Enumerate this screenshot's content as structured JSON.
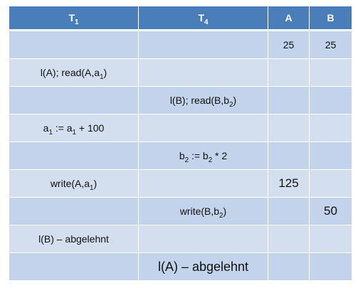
{
  "table": {
    "headers": [
      {
        "base": "T",
        "sub": "1"
      },
      {
        "base": "T",
        "sub": "4"
      },
      {
        "base": "A",
        "sub": ""
      },
      {
        "base": "B",
        "sub": ""
      }
    ],
    "rows": [
      {
        "t1": [],
        "t4": [],
        "a": "25",
        "b": "25"
      },
      {
        "t1": [
          "l(A); read(A,a",
          {
            "sub": "1"
          },
          ")"
        ],
        "t4": [],
        "a": "",
        "b": ""
      },
      {
        "t1": [],
        "t4": [
          "l(B); read(B,b",
          {
            "sub": "2"
          },
          ")"
        ],
        "a": "",
        "b": ""
      },
      {
        "t1": [
          "a",
          {
            "sub": "1"
          },
          " := a",
          {
            "sub": "1"
          },
          " + 100"
        ],
        "t4": [],
        "a": "",
        "b": ""
      },
      {
        "t1": [],
        "t4": [
          "b",
          {
            "sub": "2"
          },
          " := b",
          {
            "sub": "2"
          },
          " * 2"
        ],
        "a": "",
        "b": ""
      },
      {
        "t1": [
          "write(A,a",
          {
            "sub": "1"
          },
          ")"
        ],
        "t4": [],
        "a": "125",
        "b": ""
      },
      {
        "t1": [],
        "t4": [
          "write(B,b",
          {
            "sub": "2"
          },
          ")"
        ],
        "a": "",
        "b": "50"
      },
      {
        "t1": [
          "l(B) – abgelehnt"
        ],
        "t4": [],
        "a": "",
        "b": ""
      },
      {
        "t1": [],
        "t4": [
          "l(A) – abgelehnt"
        ],
        "a": "",
        "b": ""
      }
    ]
  }
}
